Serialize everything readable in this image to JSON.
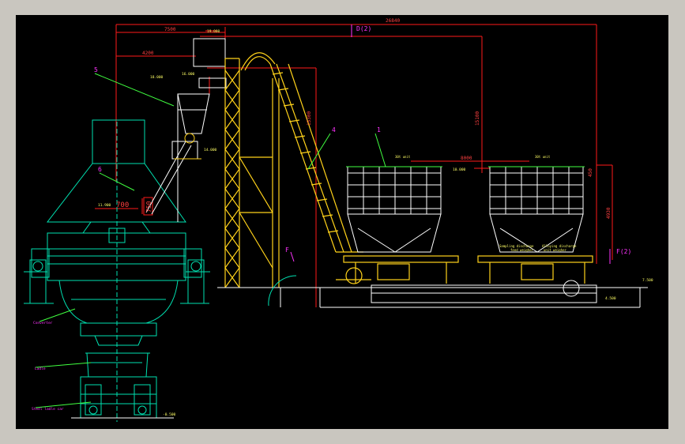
{
  "colors": {
    "background": "#000000",
    "frame": "#c9c6bf",
    "dimension": "#ff1a1a",
    "converter": "#00e0b0",
    "conveyor": "#ffd21a",
    "hopper": "#ffffff",
    "label": "#ff33ff",
    "leader": "#40ff40",
    "annotation": "#ffff66"
  },
  "dimensions": {
    "overall": "26840",
    "span_a": "7500",
    "span_b": "4200",
    "span_c": "8000",
    "height_conveyor": "15300",
    "height_mid": "15100",
    "height_right": "4930",
    "converter_offset": "700",
    "converter_height": "750",
    "bunker_top": "450"
  },
  "view_markers": {
    "d": "D(2)",
    "f": "F(2)",
    "f_small": "F"
  },
  "leader_labels": {
    "n1": "1",
    "n4": "4",
    "n5": "5",
    "n6": "6"
  },
  "elevations": {
    "e1": "19.000",
    "e2": "18.000",
    "e3": "16.000",
    "e4": "14.000",
    "e5": "11.900",
    "e6": "7.500",
    "e7": "4.500",
    "e8": "10.000",
    "e9": "-0.500"
  },
  "component_labels": {
    "converter": "Converter",
    "ladle": "Ladle",
    "steel_ladle_car": "Steel ladle car"
  },
  "bunker_labels": {
    "left_top": "30t unit",
    "right_top": "30t unit",
    "left_weigh": "Sampling discharge",
    "left_weigh_sub": "feed weigher",
    "right_weigh": "Alloying discharge",
    "right_weigh_sub": "unit weigher"
  }
}
